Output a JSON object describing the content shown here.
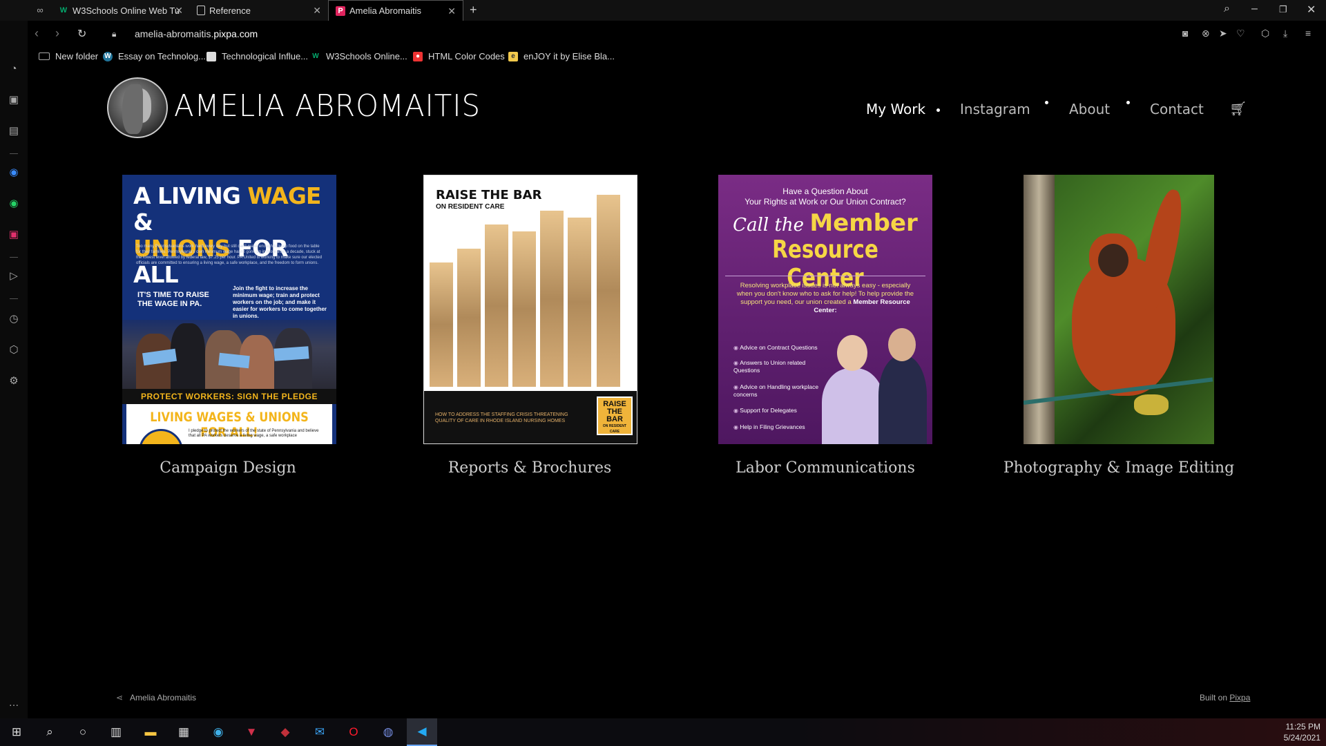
{
  "browser": {
    "tabs": [
      {
        "label": "W3Schools Online Web Tu",
        "favicon": "W",
        "favicon_color": "#04aa6d",
        "active": false
      },
      {
        "label": "Reference",
        "favicon": "doc",
        "favicon_color": "#dddddd",
        "active": false
      },
      {
        "label": "Amelia Abromaitis",
        "favicon": "P",
        "favicon_color": "#e0245e",
        "active": true
      }
    ],
    "url_prefix": "amelia-abromaitis.",
    "url_domain": "pixpa.com",
    "bookmarks": [
      {
        "label": "New folder",
        "icon": "folder-icon"
      },
      {
        "label": "Essay on Technolog...",
        "icon": "wordpress-icon"
      },
      {
        "label": "Technological Influe...",
        "icon": "page-icon"
      },
      {
        "label": "W3Schools Online...",
        "icon": "w3schools-icon"
      },
      {
        "label": "HTML Color Codes",
        "icon": "color-codes-icon"
      },
      {
        "label": "enJOY it by Elise Bla...",
        "icon": "enjoy-icon"
      }
    ]
  },
  "site": {
    "brand": "AMELIA ABROMAITIS",
    "nav": [
      {
        "label": "My Work",
        "active": true
      },
      {
        "label": "Instagram",
        "active": false
      },
      {
        "label": "About",
        "active": false
      },
      {
        "label": "Contact",
        "active": false
      }
    ],
    "cards": [
      {
        "title": "Campaign Design",
        "poster": {
          "line1a": "A LIVING ",
          "line1b": "WAGE",
          "line1c": " &",
          "line2a": "UNIONS",
          "line2b": " FOR ALL",
          "blurb": "Too many Pennsylvanians work hard every day but still can't make enough to keep food on the table for their families. Pennsylvania's own minimum wage hasn't gone up in more than a decade, stuck at the lowest level allowed by federal law, $7.25 per hour. PA United is working to make sure our elected officials are committed to ensuring a living wage, a safe workplace, and the freedom to form unions.",
          "subhead": "IT'S TIME TO RAISE THE WAGE IN PA.",
          "subhead2": "Join the fight to increase the minimum wage; train and protect workers on the job; and make it easier for workers to come together in unions.",
          "band": "PROTECT WORKERS: SIGN THE PLEDGE",
          "pledge_title": "LIVING WAGES & UNIONS FOR ALL!",
          "pledge_text": "I pledge to protect the workers of the state of Pennsylvania and believe that all PA workers deserve a living wage, a safe workplace"
        }
      },
      {
        "title": "Reports & Brochures",
        "poster": {
          "title": "RAISE THE BAR",
          "subtitle": "ON RESIDENT CARE",
          "footer_text": "HOW TO ADDRESS THE STAFFING CRISIS THREATENING QUALITY OF CARE IN RHODE ISLAND NURSING HOMES",
          "badge_line1": "RAISE",
          "badge_line2": "THE",
          "badge_line3": "BAR",
          "badge_line4": "ON RESIDENT CARE"
        }
      },
      {
        "title": "Labor Communications",
        "poster": {
          "q1": "Have a Question About",
          "q2": "Your Rights at Work or Our Union Contract?",
          "call": "Call the ",
          "member": "Member",
          "mrc": "Resource Center",
          "body_a": "Resolving workplace issues is not always easy - especially when you don't know who to ask for help! To help provide the support you need, our union created a ",
          "body_b": "Member Resource Center:",
          "items": [
            "Advice on Contract Questions",
            "Answers to Union related Questions",
            "Advice on Handling workplace concerns",
            "Support for Delegates",
            "Help in Filing Grievances"
          ]
        }
      },
      {
        "title": "Photography & Image Editing",
        "photo": "orangutan-photo"
      }
    ],
    "footer": {
      "name": "Amelia Abromaitis",
      "built_prefix": "Built on ",
      "built_link": "Pixpa"
    }
  },
  "taskbar": {
    "time": "11:25 PM",
    "date": "5/24/2021"
  }
}
